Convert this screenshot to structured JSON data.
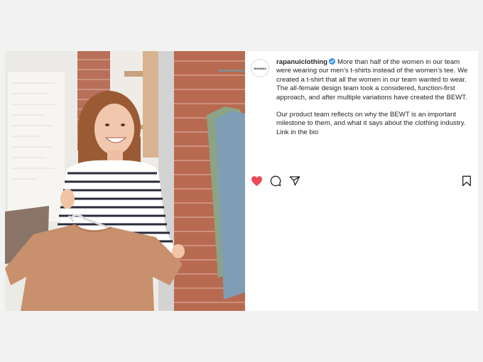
{
  "post": {
    "avatar_text": "RAPANUI",
    "username": "rapanuiclothing",
    "verified": true,
    "caption_paragraphs": [
      "More than half of the women in our team were wearing our men’s t-shirts instead of the women’s tee. We created a t-shirt that all the women in our team wanted to wear. The all-female design team took a considered, function-first approach, and after multiple variations have created the BEWT.",
      "Our product team reflects on why the BEWT is an important milestone to them, and what it says about the clothing industry. Link in the bio"
    ],
    "liked": true
  },
  "icons": {
    "like": "heart-icon",
    "comment": "comment-icon",
    "share": "paper-plane-icon",
    "save": "bookmark-icon",
    "verified": "verified-badge-icon"
  },
  "colors": {
    "like_red": "#ed4956",
    "verified_blue": "#3897f0",
    "text": "#262626"
  }
}
